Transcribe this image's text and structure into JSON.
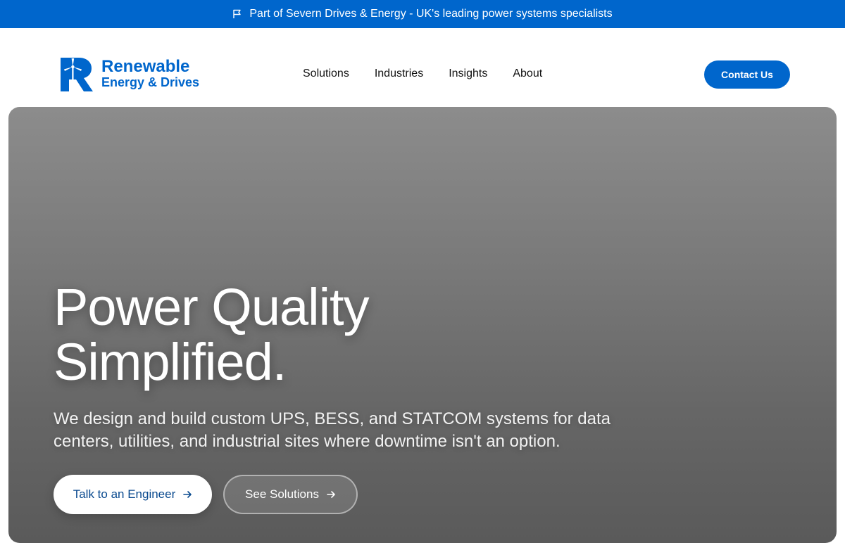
{
  "topbar": {
    "icon": "flag-icon",
    "text": "Part of Severn Drives & Energy - UK's leading power systems specialists",
    "background": "#0066cc"
  },
  "header": {
    "logo": {
      "icon": "turbine-logo-icon",
      "line1": "Renewable",
      "line2": "Energy & Drives",
      "color": "#0066cc"
    },
    "nav": [
      {
        "label": "Solutions"
      },
      {
        "label": "Industries"
      },
      {
        "label": "Insights"
      },
      {
        "label": "About"
      }
    ],
    "contact_label": "Contact Us"
  },
  "hero": {
    "title_line1": "Power Quality",
    "title_line2": "Simplified.",
    "subtitle_line1": "We design and build custom UPS, BESS, and STATCOM systems for data",
    "subtitle_line2": "centers, utilities, and industrial sites where downtime isn't an option.",
    "primary_cta": "Talk to an Engineer",
    "secondary_cta": "See Solutions",
    "cta_icon": "arrow-right-icon"
  }
}
